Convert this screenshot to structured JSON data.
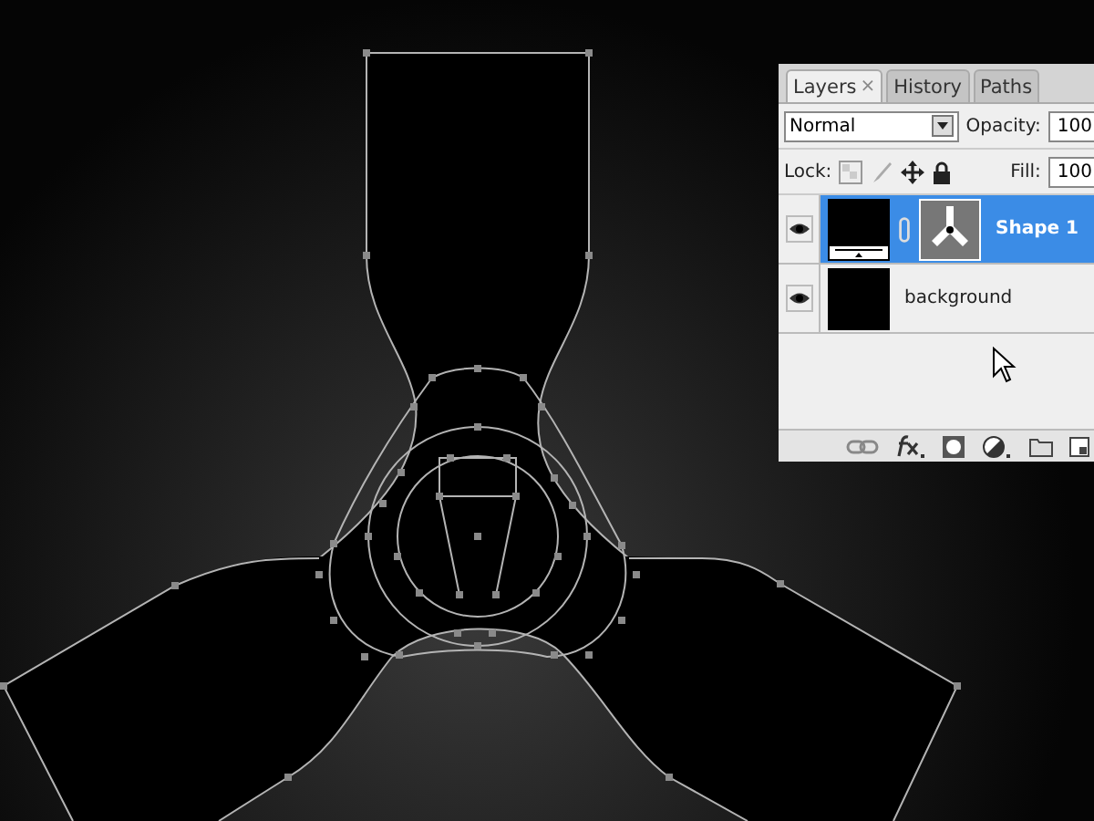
{
  "layers_panel": {
    "tabs": [
      {
        "label": "Layers",
        "selected": true,
        "close": "×"
      },
      {
        "label": "History",
        "selected": false
      },
      {
        "label": "Paths",
        "selected": false
      }
    ],
    "blend_mode": "Normal",
    "opacity_label": "Opacity:",
    "opacity_value": "100",
    "lock_label": "Lock:",
    "fill_label": "Fill:",
    "fill_value": "100",
    "layers": [
      {
        "name": "Shape 1",
        "selected": true,
        "visible": true,
        "kind": "shape"
      },
      {
        "name": "background",
        "selected": false,
        "visible": true,
        "kind": "fill"
      }
    ]
  }
}
